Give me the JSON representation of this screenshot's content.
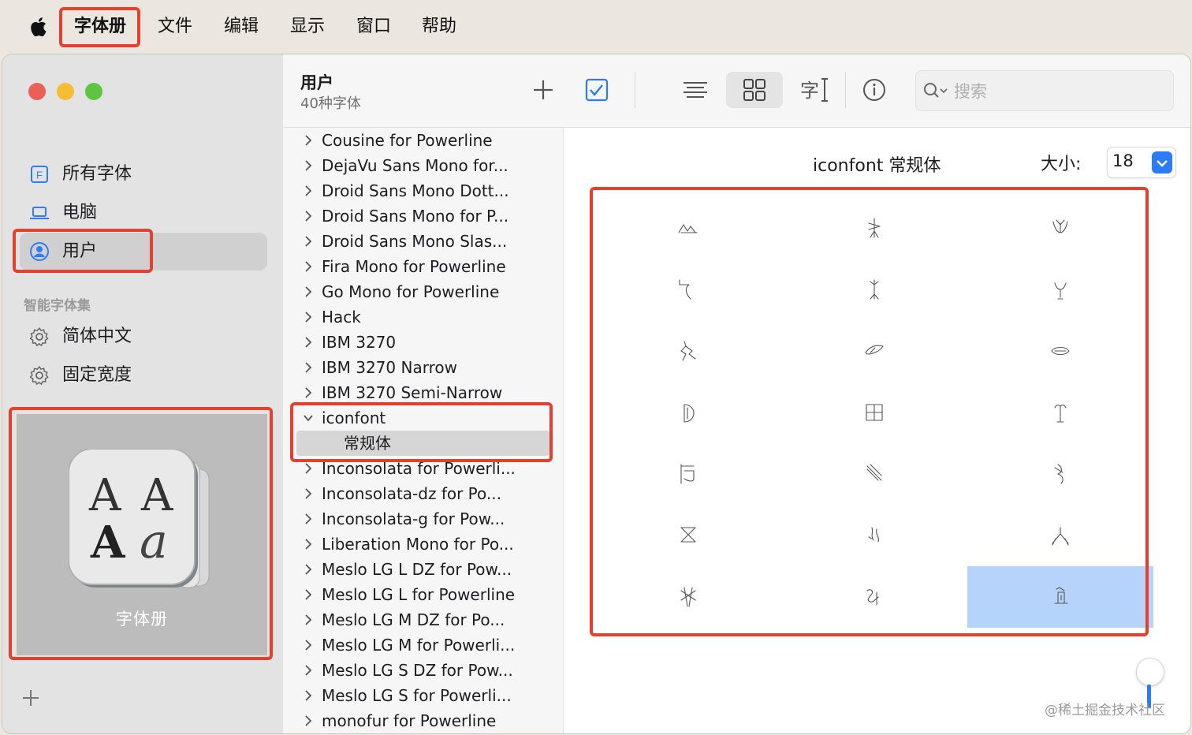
{
  "menubar": {
    "app": "字体册",
    "items": [
      "文件",
      "编辑",
      "显示",
      "窗口",
      "帮助"
    ]
  },
  "sidebar": {
    "items": [
      {
        "label": "所有字体",
        "icon": "font-collection-icon"
      },
      {
        "label": "电脑",
        "icon": "laptop-icon"
      },
      {
        "label": "用户",
        "icon": "user-circle-icon",
        "selected": true
      }
    ],
    "smart_header": "智能字体集",
    "smart_items": [
      {
        "label": "简体中文",
        "icon": "gear-icon"
      },
      {
        "label": "固定宽度",
        "icon": "gear-icon"
      }
    ],
    "app_card": {
      "label": "字体册"
    }
  },
  "toolbar": {
    "title": "用户",
    "subtitle": "40种字体",
    "search_placeholder": "搜索"
  },
  "font_list": [
    "Cousine for Powerline",
    "DejaVu Sans Mono for...",
    "Droid Sans Mono Dott...",
    "Droid Sans Mono for P...",
    "Droid Sans Mono Slas...",
    "Fira Mono for Powerline",
    "Go Mono for Powerline",
    "Hack",
    "IBM 3270",
    "IBM 3270 Narrow",
    "IBM 3270 Semi-Narrow",
    "iconfont",
    "常规体",
    "Inconsolata for Powerli...",
    "Inconsolata-dz for Po...",
    "Inconsolata-g for Pow...",
    "Liberation Mono for Po...",
    "Meslo LG L DZ for Pow...",
    "Meslo LG L for Powerline",
    "Meslo LG M DZ for Po...",
    "Meslo LG M for Powerli...",
    "Meslo LG S DZ for Pow...",
    "Meslo LG S for Powerli...",
    "monofur for Powerline"
  ],
  "expanded_font": "iconfont",
  "selected_style": "常规体",
  "preview": {
    "title": "iconfont 常规体",
    "size_label": "大小:",
    "size_value": "18",
    "selected_glyph_index": 20,
    "glyph_count": 21
  },
  "watermark": "@稀土掘金技术社区",
  "colors": {
    "highlight_box": "#e5402e",
    "accent": "#2b7cf6",
    "selected_glyph_bg": "#b6d4fb"
  }
}
